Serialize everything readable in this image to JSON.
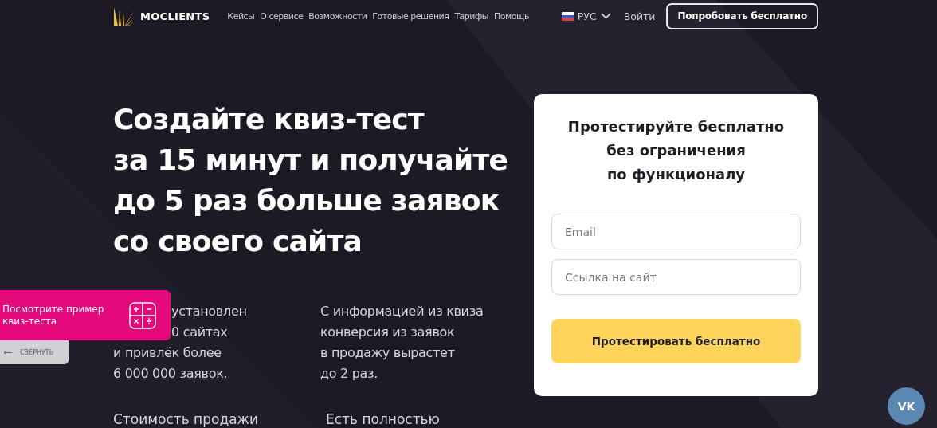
{
  "header": {
    "brand": "MOCLIENTS",
    "nav": [
      "Кейсы",
      "О сервисе",
      "Возможности",
      "Готовые решения",
      "Тарифы",
      "Помощь"
    ],
    "language": "РУС",
    "login": "Войти",
    "cta": "Попробовать бесплатно"
  },
  "hero": {
    "title_lines": [
      "Создайте квиз-тест",
      "за 15 минут и получайте",
      "до 5 раз больше заявок",
      "со своего сайта"
    ]
  },
  "stats": [
    {
      "partly_covered_lines": [
        "установлен",
        "0 сайтах"
      ],
      "lines": [
        "и привлёк более",
        "6 000 000 заявок."
      ]
    },
    {
      "lines": [
        "С информацией из квиза",
        "конверсия из заявок",
        "в продажу вырастет",
        "до 2 раз."
      ]
    }
  ],
  "more_stats": [
    "Стоимость продажи",
    "Есть полностью"
  ],
  "form": {
    "title_lines": [
      "Протестируйте бесплатно",
      "без ограничения",
      "по функционалу"
    ],
    "fields": [
      {
        "placeholder": "Email"
      },
      {
        "placeholder": "Ссылка на сайт"
      }
    ],
    "submit": "Протестировать бесплатно"
  },
  "quiz_popup": {
    "text": "Посмотрите пример квиз-теста",
    "collapse": "СВЕРНУТЬ"
  },
  "social": {
    "label": "VK"
  }
}
